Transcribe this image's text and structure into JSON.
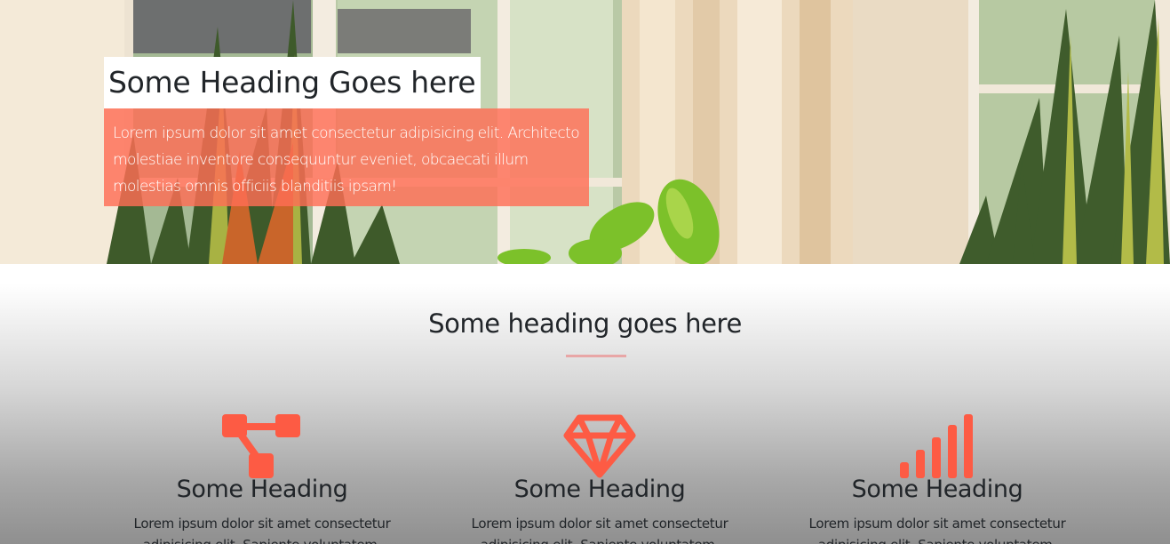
{
  "hero": {
    "title": "Some Heading Goes here",
    "text": "Lorem ipsum dolor sit amet consectetur adipisicing elit. Architecto molestiae inventore consequuntur eveniet, obcaecati illum molestias omnis officiis blanditiis ipsam!",
    "overlay_color": "#ff6e55"
  },
  "features": {
    "title": "Some heading goes here",
    "accent_color": "#fd5b44",
    "divider_color": "#e8a6a6",
    "items": [
      {
        "icon": "sitemap-icon",
        "heading": "Some Heading",
        "text": "Lorem ipsum dolor sit amet consectetur adipisicing elit. Sapiente voluptatem."
      },
      {
        "icon": "gem-icon",
        "heading": "Some Heading",
        "text": "Lorem ipsum dolor sit amet consectetur adipisicing elit. Sapiente voluptatem."
      },
      {
        "icon": "signal-icon",
        "heading": "Some Heading",
        "text": "Lorem ipsum dolor sit amet consectetur adipisicing elit. Sapiente voluptatem."
      }
    ]
  }
}
